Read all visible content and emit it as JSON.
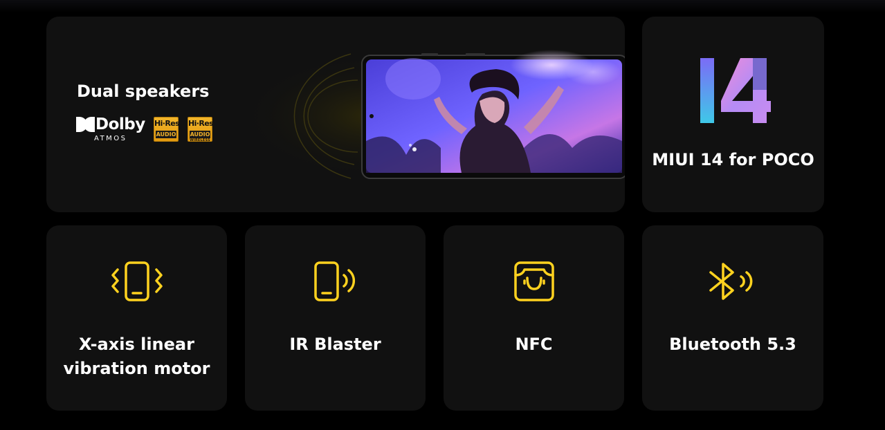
{
  "speakers": {
    "title": "Dual speakers",
    "dolby_label": "Dolby",
    "dolby_sub": "ATMOS",
    "hires_top": "Hi·Res",
    "hires_audio": "AUDIO",
    "hires_wireless": "WIRELESS"
  },
  "miui": {
    "label": "MIUI 14 for POCO"
  },
  "features": [
    {
      "line1": "X-axis linear",
      "line2": "vibration motor",
      "icon": "vibration-phone-icon"
    },
    {
      "line1": "IR Blaster",
      "line2": "",
      "icon": "ir-phone-icon"
    },
    {
      "line1": "NFC",
      "line2": "",
      "icon": "nfc-icon"
    },
    {
      "line1": "Bluetooth 5.3",
      "line2": "",
      "icon": "bluetooth-icon"
    }
  ],
  "colors": {
    "accent": "#ffd21f",
    "card_bg": "#111111",
    "page_bg": "#000000"
  }
}
